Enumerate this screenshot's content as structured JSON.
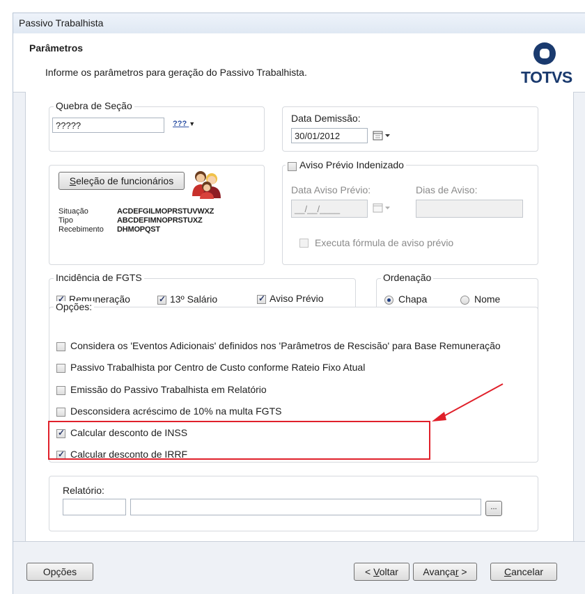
{
  "window": {
    "title": "Passivo Trabalhista"
  },
  "header": {
    "title": "Parâmetros",
    "description": "Informe os parâmetros para geração do Passivo Trabalhista.",
    "logo_text": "TOTVS",
    "logo_color": "#1a3a6e"
  },
  "quebra_secao": {
    "legend": "Quebra de Seção",
    "value": "?????",
    "dropdown_label": "???"
  },
  "data_demissao": {
    "label": "Data Demissão:",
    "value": "30/01/2012"
  },
  "selecao": {
    "button_prefix": "",
    "button_mnemonic": "S",
    "button_rest": "eleção de funcionários",
    "rows": [
      {
        "key": "Situação",
        "value": "ACDEFGILMOPRSTUVWXZ"
      },
      {
        "key": "Tipo",
        "value": "ABCDEFIMNOPRSTUXZ"
      },
      {
        "key": "Recebimento",
        "value": "DHMOPQST"
      }
    ]
  },
  "aviso": {
    "legend": "Aviso Prévio Indenizado",
    "checked": false,
    "data_label": "Data Aviso Prévio:",
    "data_value": "__/__/____",
    "dias_label": "Dias de Aviso:",
    "formula_label": "Executa fórmula de aviso prévio"
  },
  "fgts": {
    "legend": "Incidência de FGTS",
    "items": [
      {
        "label": "Remuneração",
        "checked": true
      },
      {
        "label": "13º Salário",
        "checked": true
      },
      {
        "label": "Aviso Prévio",
        "checked": true
      }
    ]
  },
  "ordenacao": {
    "legend": "Ordenação",
    "options": [
      {
        "label": "Chapa",
        "selected": true
      },
      {
        "label": "Nome",
        "selected": false
      }
    ]
  },
  "opcoes": {
    "legend": "Opções:",
    "items": [
      {
        "label": "Considera os 'Eventos Adicionais' definidos nos 'Parâmetros de Rescisão' para Base Remuneração",
        "checked": false
      },
      {
        "label": "Passivo Trabalhista por Centro de Custo conforme Rateio Fixo Atual",
        "checked": false
      },
      {
        "label": "Emissão do Passivo Trabalhista em Relatório",
        "checked": false
      },
      {
        "label": "Desconsidera acréscimo de 10% na multa FGTS",
        "checked": false
      },
      {
        "label": "Calcular desconto de INSS",
        "checked": true
      },
      {
        "label": "Calcular desconto de IRRF",
        "checked": true
      }
    ]
  },
  "relatorio": {
    "label": "Relatório:",
    "code": "",
    "name": "",
    "browse_label": "..."
  },
  "footer": {
    "opcoes_label": "Opções",
    "voltar": {
      "pre": "< ",
      "mnemonic": "V",
      "rest": "oltar"
    },
    "avancar": {
      "pre": "Avança",
      "mnemonic": "r",
      "rest": " >"
    },
    "cancelar": {
      "pre": "",
      "mnemonic": "C",
      "rest": "ancelar"
    }
  },
  "annotation": {
    "highlight_color": "#e0202a"
  }
}
